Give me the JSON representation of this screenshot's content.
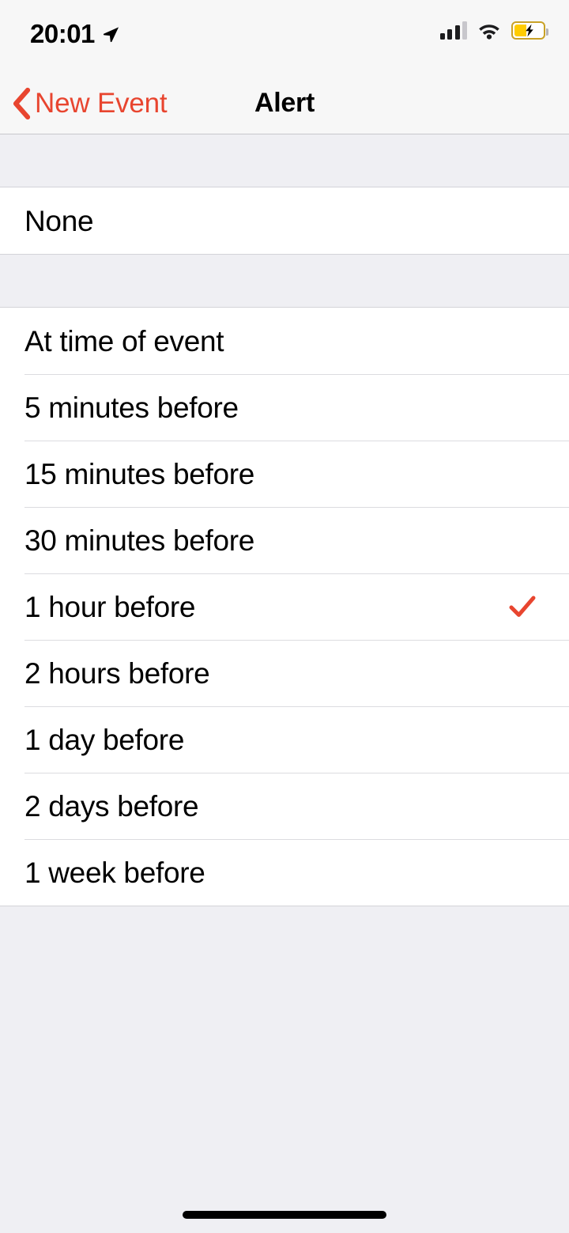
{
  "status_bar": {
    "time": "20:01",
    "location_icon": "location-arrow-icon",
    "signal_icon": "cellular-signal-icon",
    "signal_bars_filled": 3,
    "signal_bars_total": 4,
    "wifi_icon": "wifi-icon",
    "battery_icon": "battery-charging-icon",
    "battery_charging": true,
    "battery_level_percent": 40
  },
  "nav_bar": {
    "back_icon": "chevron-left-icon",
    "back_label": "New Event",
    "title": "Alert"
  },
  "colors": {
    "accent_red": "#E8452F",
    "background_gray": "#EFEFF3",
    "bar_gray": "#F7F7F7",
    "row_white": "#FFFFFF",
    "separator": "#DCDCE0",
    "battery_yellow": "#FFCC00"
  },
  "sections": [
    {
      "name": "none-section",
      "rows": [
        {
          "label": "None",
          "selected": false
        }
      ]
    },
    {
      "name": "alert-options-section",
      "rows": [
        {
          "label": "At time of event",
          "selected": false
        },
        {
          "label": "5 minutes before",
          "selected": false
        },
        {
          "label": "15 minutes before",
          "selected": false
        },
        {
          "label": "30 minutes before",
          "selected": false
        },
        {
          "label": "1 hour before",
          "selected": true
        },
        {
          "label": "2 hours before",
          "selected": false
        },
        {
          "label": "1 day before",
          "selected": false
        },
        {
          "label": "2 days before",
          "selected": false
        },
        {
          "label": "1 week before",
          "selected": false
        }
      ]
    }
  ],
  "selected_value": "1 hour before",
  "checkmark_icon": "checkmark-icon",
  "home_indicator": "home-indicator"
}
